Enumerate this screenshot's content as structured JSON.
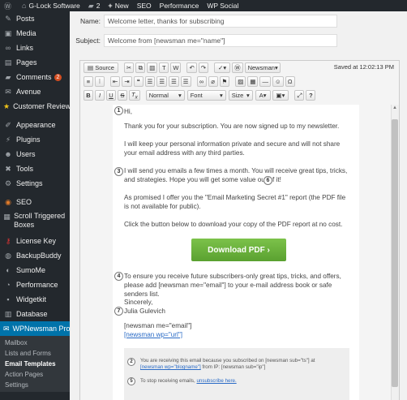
{
  "adminbar": {
    "wp_icon": "wordpress-icon",
    "site_name": "G-Lock Software",
    "comments_count": "2",
    "new_label": "New",
    "items": [
      "SEO",
      "Performance",
      "WP Social"
    ]
  },
  "sidebar": {
    "items": [
      {
        "label": "Posts",
        "icon": "pin-icon"
      },
      {
        "label": "Media",
        "icon": "media-icon"
      },
      {
        "label": "Links",
        "icon": "link-icon"
      },
      {
        "label": "Pages",
        "icon": "page-icon"
      },
      {
        "label": "Comments",
        "icon": "comment-icon",
        "badge": "2"
      },
      {
        "label": "Avenue",
        "icon": "avenue-icon"
      },
      {
        "label": "Customer Reviews",
        "icon": "star-icon"
      },
      {
        "label": "Appearance",
        "icon": "brush-icon"
      },
      {
        "label": "Plugins",
        "icon": "plugin-icon"
      },
      {
        "label": "Users",
        "icon": "user-icon"
      },
      {
        "label": "Tools",
        "icon": "wrench-icon"
      },
      {
        "label": "Settings",
        "icon": "settings-icon"
      },
      {
        "label": "SEO",
        "icon": "seo-icon"
      },
      {
        "label": "Scroll Triggered Boxes",
        "icon": "boxes-icon"
      },
      {
        "label": "License Key",
        "icon": "key-icon"
      },
      {
        "label": "BackupBuddy",
        "icon": "backup-icon"
      },
      {
        "label": "SumoMe",
        "icon": "sumome-icon"
      },
      {
        "label": "Performance",
        "icon": "performance-icon"
      },
      {
        "label": "Widgetkit",
        "icon": "widgetkit-icon"
      },
      {
        "label": "Database",
        "icon": "database-icon"
      },
      {
        "label": "WPNewsman Pro",
        "icon": "newsman-icon"
      }
    ],
    "submenu": [
      "Mailbox",
      "Lists and Forms",
      "Email Templates",
      "Action Pages",
      "Settings"
    ]
  },
  "form": {
    "name_label": "Name:",
    "name_value": "Welcome letter, thanks for subscribing",
    "subject_label": "Subject:",
    "subject_value": "Welcome from [newsman me=\"name\"]"
  },
  "editor": {
    "source_label": "Source",
    "newsman_label": "Newsman",
    "saved_text": "Saved at 12:02:13 PM",
    "format_label": "Normal",
    "font_label": "Font",
    "size_label": "Size",
    "help_label": "?"
  },
  "email": {
    "markers": [
      "1",
      "6",
      "3",
      "4",
      "7",
      "2",
      "5"
    ],
    "greeting": "Hi,",
    "p1": "Thank you for your subscription. You are now signed up to my newsletter.",
    "p2": "I will keep your personal information private and secure and will not share your email address with any third parties.",
    "p3": "I will send you emails a few times a month. You will receive great tips, tricks, and strategies. Hope you will get some value out of it!",
    "p4": "As promised I offer you the \"Email Marketing Secret #1\" report (the PDF file is not available for public).",
    "p5": "Click the button below to download your copy of the PDF report at no cost.",
    "download_button": "Download PDF ›",
    "p6": "To ensure you receive future subscribers-only great tips, tricks, and offers, please add [newsman me=\"email\"] to your e-mail address book or safe senders list.",
    "sincerely": "Sincerely,",
    "signer": "Julia Gulevich",
    "sig_email": "[newsman me=\"email\"]",
    "sig_url": "[newsman wp=\"url\"]",
    "footer1": "You are receiving this email because you subscribed on [newsman sub=\"ts\"] at",
    "footer1b_link": "[newsman wp=\"blogname\"]",
    "footer1c": "from IP: [newsman sub=\"ip\"]",
    "footer2": "To stop receiving emails,",
    "footer2_link": "unsubscribe here."
  }
}
